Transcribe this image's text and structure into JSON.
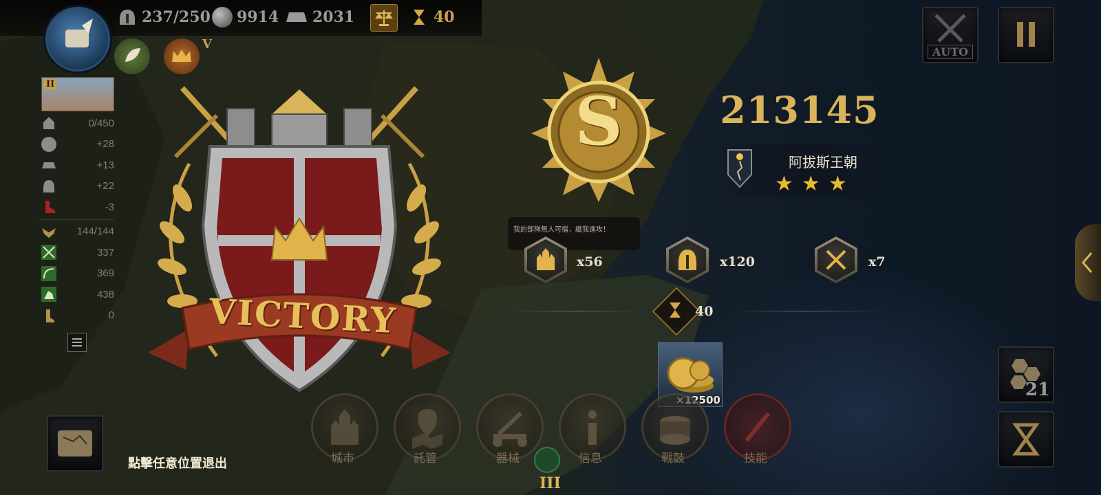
{
  "top_hud": {
    "troops": "237/250",
    "silver": "9914",
    "iron": "2031",
    "turns": "40",
    "rank_numeral": "V"
  },
  "side_panel": {
    "city_level": "II",
    "rows": [
      {
        "icon": "city-icon",
        "value": "0/450"
      },
      {
        "icon": "silver-coin-icon",
        "value": "+28"
      },
      {
        "icon": "iron-ingot-icon",
        "value": "+13"
      },
      {
        "icon": "helmet-icon",
        "value": "+22"
      },
      {
        "icon": "boot-icon",
        "value": "-3"
      },
      {
        "icon": "eagle-icon",
        "value": "144/144"
      },
      {
        "icon": "infantry-icon",
        "value": "337"
      },
      {
        "icon": "archer-icon",
        "value": "369"
      },
      {
        "icon": "cavalry-icon",
        "value": "438"
      },
      {
        "icon": "move-icon",
        "value": "0"
      }
    ]
  },
  "victory": {
    "banner_text": "VICTORY",
    "rank_letter": "S",
    "score": "213145",
    "faction_name": "阿拔斯王朝",
    "stars": 3,
    "tooltip": "我的部隊無人可擋，繼我進攻！"
  },
  "rewards": [
    {
      "icon": "cathedral-icon",
      "count": "x56"
    },
    {
      "icon": "helmet-icon",
      "count": "x120"
    },
    {
      "icon": "crossed-swords-icon",
      "count": "x7"
    }
  ],
  "turn_reward": "40",
  "coin_reward": "×12500",
  "exit_hint": "點擊任意位置退出",
  "bottom_menu": [
    {
      "label": "城市",
      "icon": "cathedral-icon"
    },
    {
      "label": "託管",
      "icon": "map-pin-icon"
    },
    {
      "label": "器械",
      "icon": "catapult-icon"
    },
    {
      "label": "信息",
      "icon": "info-icon"
    },
    {
      "label": "戰鼓",
      "icon": "drum-icon"
    },
    {
      "label": "技能",
      "icon": "skill-sword-icon"
    }
  ],
  "right_controls": {
    "auto_label": "AUTO",
    "hex_count": "21",
    "bottom_level": "III"
  },
  "colors": {
    "gold": "#d9b45a",
    "shield_red": "#7a1a1a",
    "sea": "#0f1a27"
  }
}
